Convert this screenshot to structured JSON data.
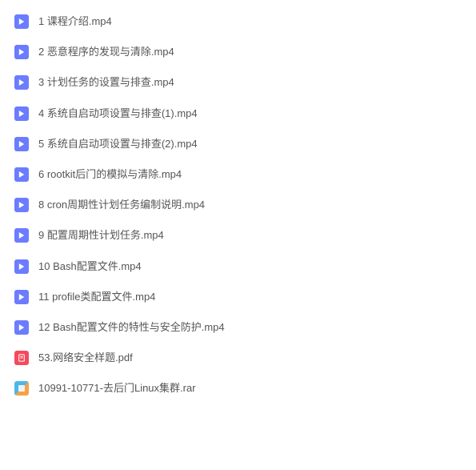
{
  "files": [
    {
      "name": "1 课程介绍.mp4",
      "type": "video"
    },
    {
      "name": "2 恶意程序的发现与清除.mp4",
      "type": "video"
    },
    {
      "name": "3 计划任务的设置与排查.mp4",
      "type": "video"
    },
    {
      "name": "4 系统自启动项设置与排查(1).mp4",
      "type": "video"
    },
    {
      "name": "5 系统自启动项设置与排查(2).mp4",
      "type": "video"
    },
    {
      "name": "6 rootkit后门的模拟与清除.mp4",
      "type": "video"
    },
    {
      "name": "8 cron周期性计划任务编制说明.mp4",
      "type": "video"
    },
    {
      "name": "9 配置周期性计划任务.mp4",
      "type": "video"
    },
    {
      "name": "10 Bash配置文件.mp4",
      "type": "video"
    },
    {
      "name": "11 profile类配置文件.mp4",
      "type": "video"
    },
    {
      "name": "12 Bash配置文件的特性与安全防护.mp4",
      "type": "video"
    },
    {
      "name": "53.网络安全样题.pdf",
      "type": "pdf"
    },
    {
      "name": "10991-10771-去后门Linux集群.rar",
      "type": "rar"
    }
  ]
}
